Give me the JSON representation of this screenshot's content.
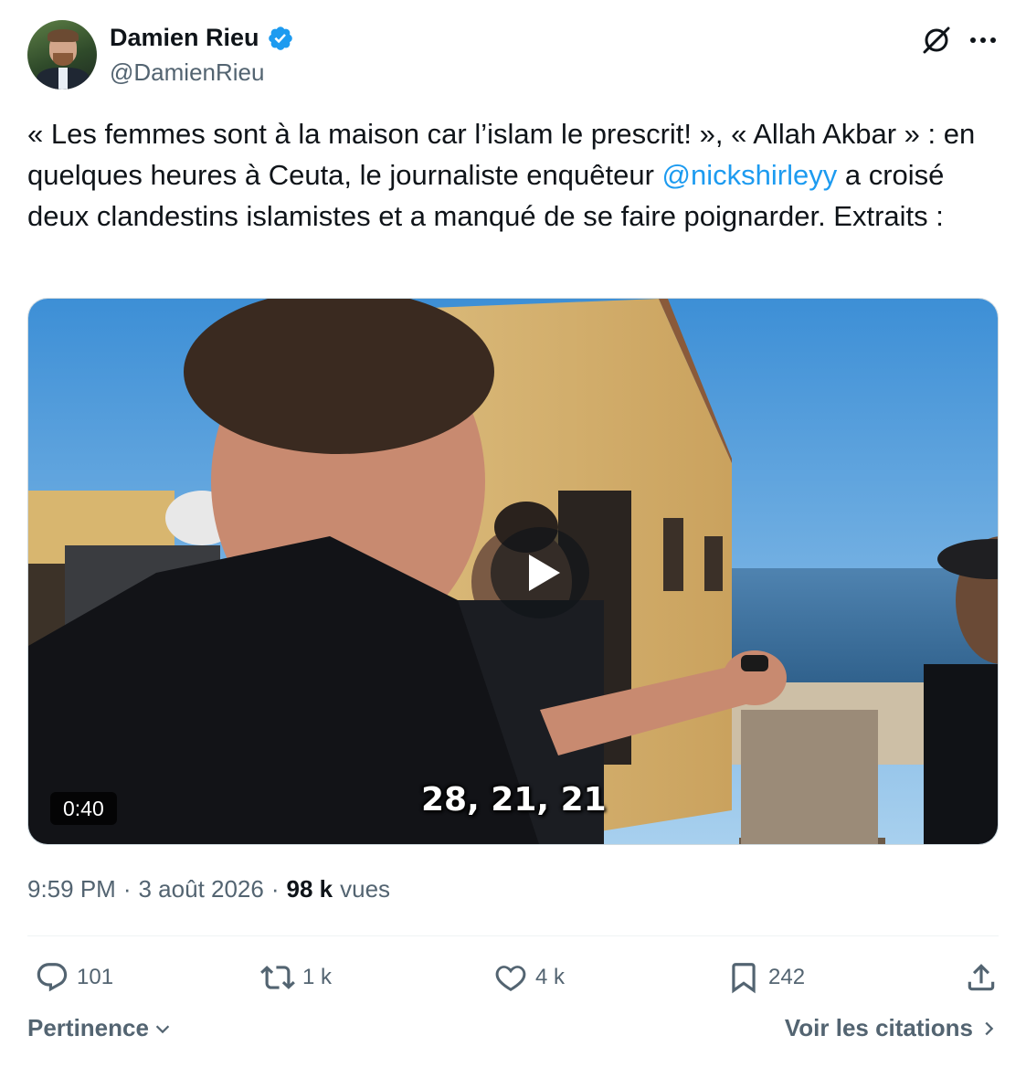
{
  "author": {
    "name": "Damien Rieu",
    "handle": "@DamienRieu",
    "verified_icon": "verified-badge-icon",
    "verified_color": "#1d9bf0"
  },
  "header_icons": {
    "grok": "grok-icon",
    "more": "more-icon"
  },
  "tweet": {
    "text_part1": "« Les femmes sont à la maison car l’islam le prescrit! », « Allah Akbar » : en quelques heures à Ceuta, le journaliste enquêteur ",
    "mention": "@nickshirleyy",
    "text_part2": " a croisé deux clandestins islamistes et a manqué de se faire poignarder. Extraits :"
  },
  "video": {
    "duration": "0:40",
    "subtitle": "28, 21, 21",
    "play_icon": "play-icon"
  },
  "meta": {
    "time": "9:59 PM",
    "separator": "·",
    "date": "3 août 2026",
    "views_count": "98 k",
    "views_label": "vues"
  },
  "actions": {
    "replies": "101",
    "reposts": "1 k",
    "likes": "4 k",
    "bookmarks": "242"
  },
  "footer": {
    "sort_label": "Pertinence",
    "quotes_label": "Voir les citations"
  },
  "colors": {
    "accent": "#1d9bf0",
    "text_primary": "#0f1419",
    "text_secondary": "#536471"
  }
}
